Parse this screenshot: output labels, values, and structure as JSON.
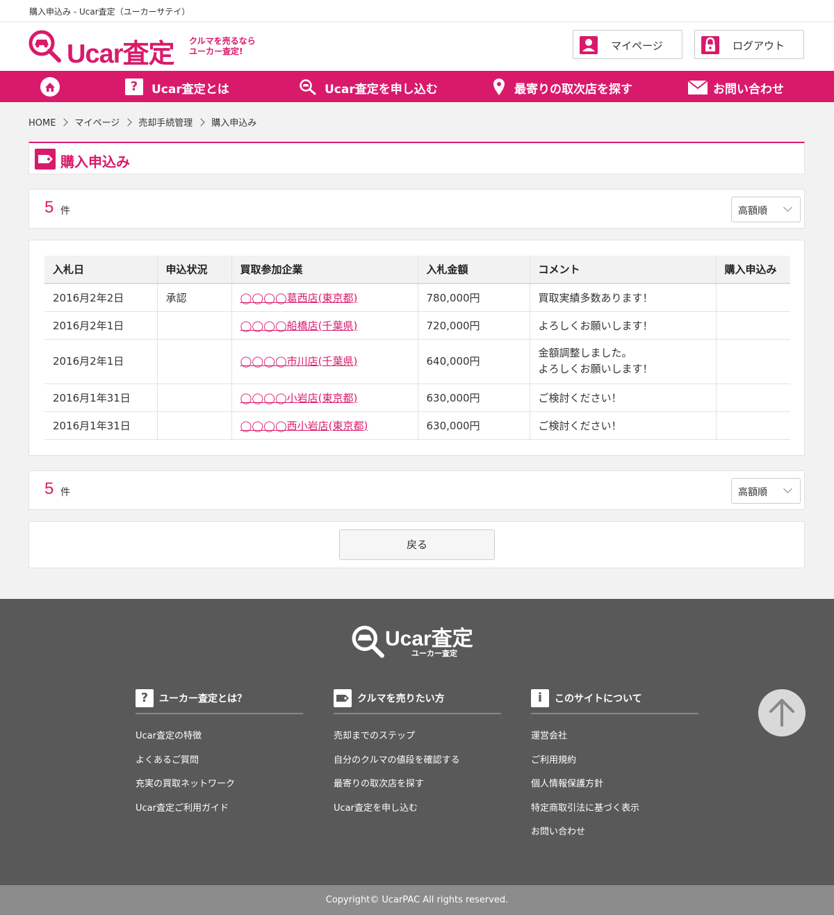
{
  "window": {
    "title": "購入申込み - Ucar査定（ユーカーサテイ）"
  },
  "header": {
    "logo_text": "Ucar査定",
    "logo_sub_line1": "クルマを売るなら",
    "logo_sub_line2": "ユーカー査定!",
    "mypage_label": "マイページ",
    "logout_label": "ログアウト"
  },
  "nav": {
    "items": [
      {
        "label": "Ucar査定とは"
      },
      {
        "label": "Ucar査定を申し込む"
      },
      {
        "label": "最寄りの取次店を探す"
      },
      {
        "label": "お問い合わせ"
      }
    ]
  },
  "breadcrumb": [
    "HOME",
    "マイページ",
    "売却手続管理",
    "購入申込み"
  ],
  "page_title": "購入申込み",
  "result_count": {
    "number": "5",
    "unit": "件"
  },
  "sort": {
    "selected": "高額順"
  },
  "table": {
    "columns": [
      "入札日",
      "申込状況",
      "買取参加企業",
      "入札金額",
      "コメント",
      "購入申込み"
    ],
    "rows": [
      {
        "date": "2016月2年2日",
        "status": "承認",
        "company": "◯◯◯◯葛西店(東京都)",
        "amount": "780,000円",
        "comment_line1": "買取実績多数あります！",
        "comment_line2": "",
        "apply": ""
      },
      {
        "date": "2016月2年1日",
        "status": "",
        "company": "◯◯◯◯船橋店(千葉県)",
        "amount": "720,000円",
        "comment_line1": "よろしくお願いします！",
        "comment_line2": "",
        "apply": ""
      },
      {
        "date": "2016月2年1日",
        "status": "",
        "company": "◯◯◯◯市川店(千葉県)",
        "amount": "640,000円",
        "comment_line1": "金額調整しました。",
        "comment_line2": "よろしくお願いします！",
        "apply": ""
      },
      {
        "date": "2016月1年31日",
        "status": "",
        "company": "◯◯◯◯小岩店(東京都)",
        "amount": "630,000円",
        "comment_line1": "ご検討ください！",
        "comment_line2": "",
        "apply": ""
      },
      {
        "date": "2016月1年31日",
        "status": "",
        "company": "◯◯◯◯西小岩店(東京都)",
        "amount": "630,000円",
        "comment_line1": "ご検討ください！",
        "comment_line2": "",
        "apply": ""
      }
    ]
  },
  "back_button": "戻る",
  "footer": {
    "logo_text": "Ucar査定",
    "logo_sub": "ユーカー査定",
    "columns": [
      {
        "icon_glyph": "?",
        "title": "ユーカー査定とは？",
        "links": [
          "Ucar査定の特徴",
          "よくあるご質問",
          "充実の買取ネットワーク",
          "Ucar査定ご利用ガイド"
        ]
      },
      {
        "icon_glyph": "",
        "title": "クルマを売りたい方",
        "links": [
          "売却までのステップ",
          "自分のクルマの値段を確認する",
          "最寄りの取次店を探す",
          "Ucar査定を申し込む"
        ]
      },
      {
        "icon_glyph": "i",
        "title": "このサイトについて",
        "links": [
          "運営会社",
          "ご利用規約",
          "個人情報保護方針",
          "特定商取引法に基づく表示",
          "お問い合わせ"
        ]
      }
    ],
    "copyright": "Copyright© UcarPAC All rights reserved."
  },
  "colors": {
    "accent": "#d91a6b",
    "footer_bg": "#595959",
    "copyright_bg": "#8c8c8c"
  }
}
